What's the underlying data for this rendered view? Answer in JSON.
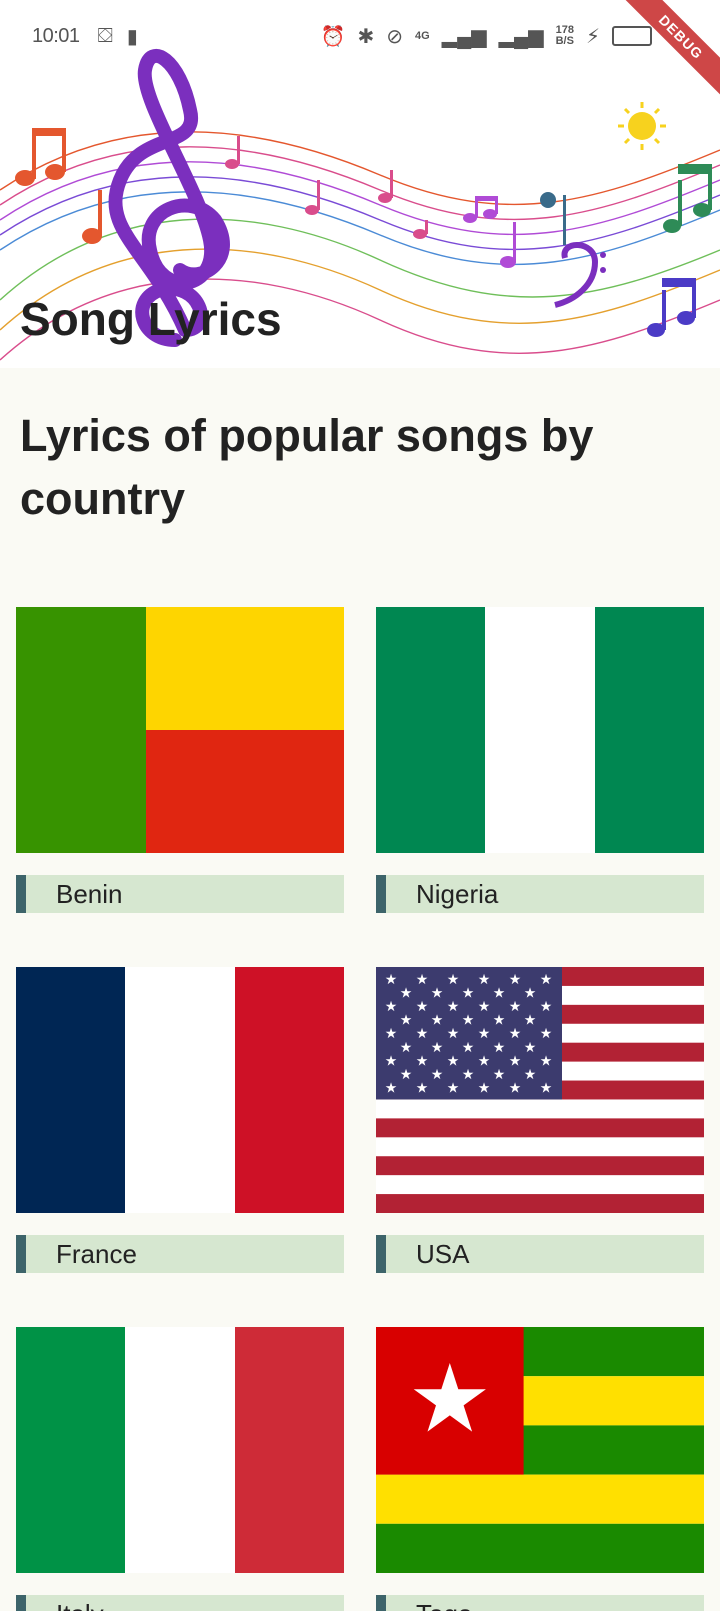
{
  "status_bar": {
    "time": "10:01",
    "network_speed_value": "178",
    "network_speed_unit": "B/S",
    "network_type": "4G",
    "debug_label": "DEBUG"
  },
  "header": {
    "title": "Song Lyrics"
  },
  "main": {
    "heading": "Lyrics of popular songs by country",
    "countries": [
      {
        "name": "Benin"
      },
      {
        "name": "Nigeria"
      },
      {
        "name": "France"
      },
      {
        "name": "USA"
      },
      {
        "name": "Italy"
      },
      {
        "name": "Togo"
      }
    ]
  },
  "colors": {
    "page_background": "#fafaf4",
    "label_background": "#d6e7d0",
    "label_accent": "#3d646a"
  }
}
